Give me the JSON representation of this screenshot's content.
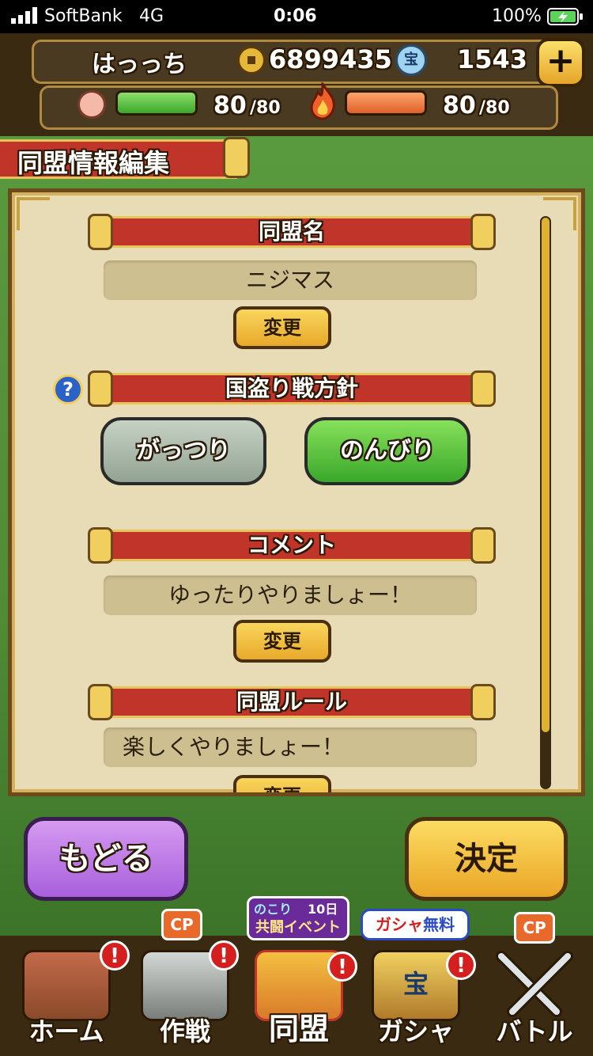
{
  "status_bar": {
    "carrier": "SoftBank",
    "network": "4G",
    "time": "0:06",
    "battery": "100%"
  },
  "header": {
    "player_name": "はっっち",
    "coins": "6899435",
    "treasure_badge": "宝",
    "gems": "1543",
    "stamina": "80",
    "stamina_max": "/80",
    "stamina_level": 1.0,
    "energy": "80",
    "energy_max": "/80",
    "energy_level": 1.0
  },
  "page_title": "同盟情報編集",
  "panel": {
    "alliance_name_heading": "同盟名",
    "alliance_name_value": "ニジマス",
    "change_label": "変更",
    "policy_heading": "国盗り戦方針",
    "help_icon_label": "?",
    "policy_options": [
      "がっつり",
      "のんびり"
    ],
    "policy_selected": "のんびり",
    "comment_heading": "コメント",
    "comment_value": "ゆったりやりましょー！",
    "rules_heading": "同盟ルール",
    "rules_value": "楽しくやりましょー！",
    "scroll_position": 0.0
  },
  "buttons": {
    "back": "もどる",
    "confirm": "決定"
  },
  "tabs": [
    {
      "label": "ホーム",
      "badge": "!"
    },
    {
      "label": "作戦",
      "badge": "!",
      "cp": "CP"
    },
    {
      "label": "同盟",
      "badge": "!",
      "event_remaining": "のこり",
      "event_days": "10日",
      "event_name": "共闘イベント"
    },
    {
      "label": "ガシャ",
      "badge": "!",
      "gacha_banner_a": "ガシャ",
      "gacha_banner_b": "無料",
      "icon_text": "宝"
    },
    {
      "label": "バトル",
      "cp": "CP"
    }
  ],
  "colors": {
    "ribbon_red": "#c0342a",
    "gold": "#f0c53a",
    "green_button": "#5cc63a",
    "gray_button": "#a9b7a8",
    "purple_button": "#b16be0"
  }
}
